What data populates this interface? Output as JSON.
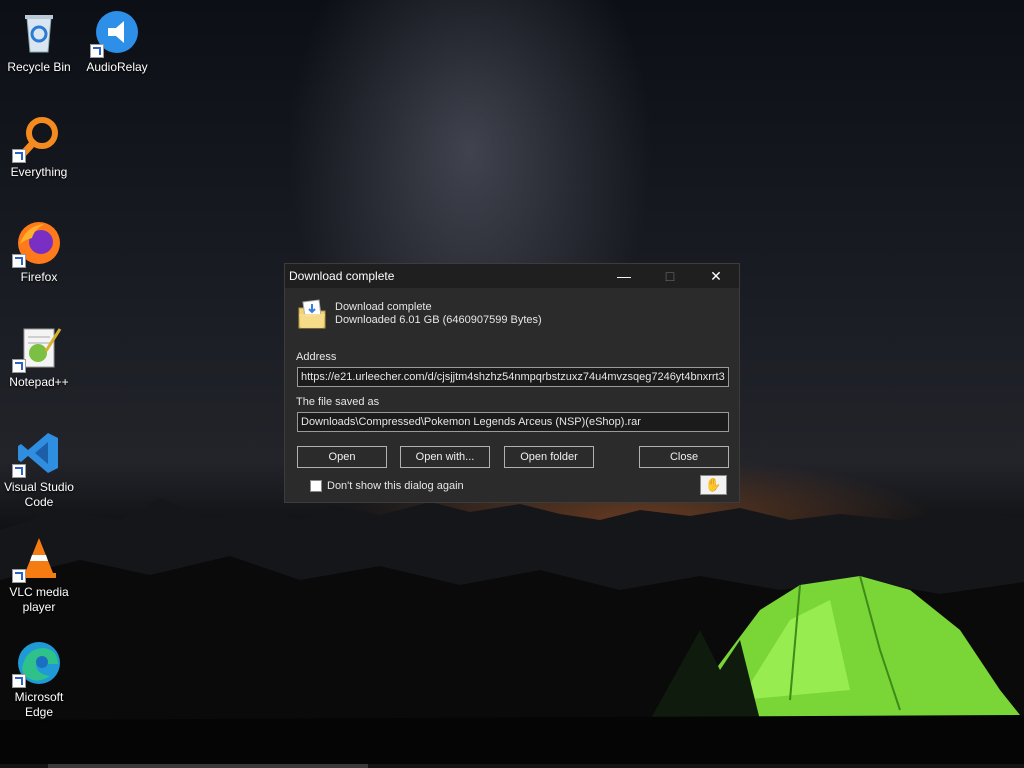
{
  "desktop": {
    "icons": [
      {
        "label": "Recycle Bin",
        "icon": "recycle-bin-icon"
      },
      {
        "label": "AudioRelay",
        "icon": "audiorelay-icon"
      },
      {
        "label": "Everything",
        "icon": "everything-icon"
      },
      {
        "label": "Firefox",
        "icon": "firefox-icon"
      },
      {
        "label": "Notepad++",
        "icon": "notepadpp-icon"
      },
      {
        "label": "Visual Studio Code",
        "icon": "vscode-icon"
      },
      {
        "label": "VLC media player",
        "icon": "vlc-icon"
      },
      {
        "label": "Microsoft Edge",
        "icon": "edge-icon"
      }
    ]
  },
  "dialog": {
    "title": "Download complete",
    "heading": "Download complete",
    "downloaded_text": "Downloaded 6.01  GB (6460907599 Bytes)",
    "address_label": "Address",
    "address_value": "https://e21.urleecher.com/d/cjsjjtm4shzhz54nmpqrbstzuxz74u4mvzsqeg7246yt4bnxrrt3",
    "saved_label": "The file saved as",
    "saved_value": "Downloads\\Compressed\\Pokemon Legends Arceus (NSP)(eShop).rar",
    "buttons": {
      "open": "Open",
      "open_with": "Open with...",
      "open_folder": "Open folder",
      "close": "Close"
    },
    "dont_show_label": "Don't show this dialog again",
    "dont_show_checked": false
  },
  "colors": {
    "dialog_bg": "#2b2b2b",
    "titlebar_bg": "#1f1f1f",
    "tent_green": "#7fe03a"
  }
}
